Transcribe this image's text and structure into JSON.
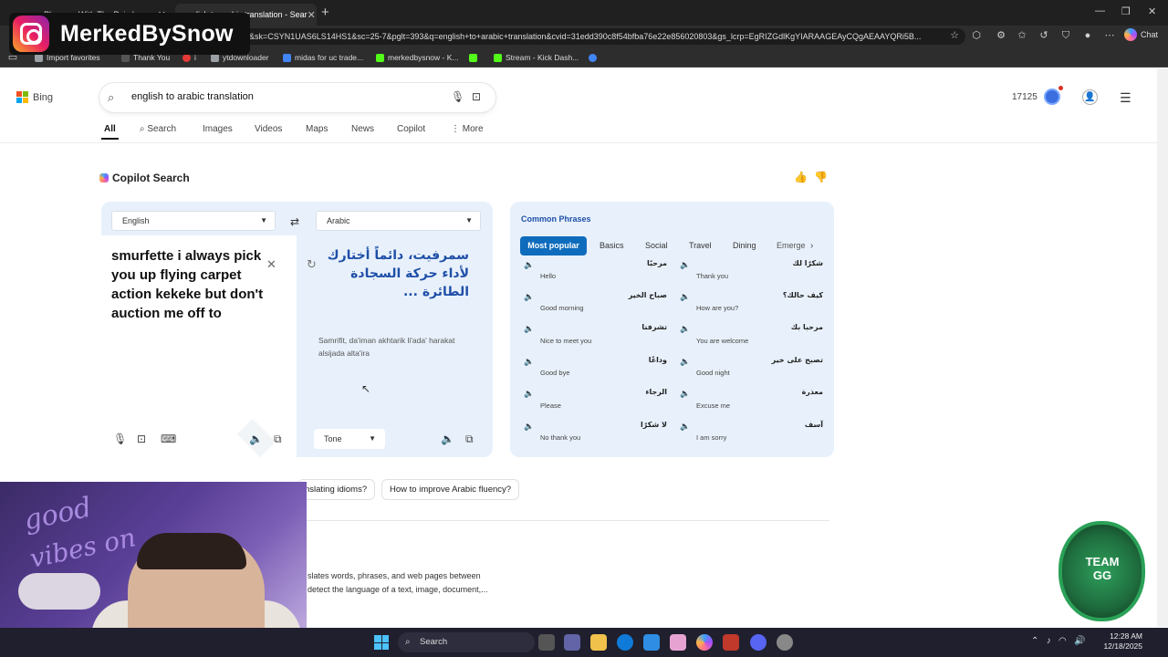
{
  "browser": {
    "tabs": [
      {
        "label": "Pleasure With The Pain by",
        "close": "✕"
      },
      {
        "label": "english to arabic translation - Sear",
        "close": "✕"
      }
    ],
    "new_tab": "+",
    "url": "h&sk=CSYN1UAS6LS14HS1&sc=25-7&pglt=393&q=english+to+arabic+translation&cvid=31edd390c8f54bfba76e22e856020803&gs_lcrp=EgRIZGdlKgYIARAAGEAyCQgAEAAYQRi5B...",
    "chat_label": "Chat",
    "favorites": [
      {
        "label": "Import favorites",
        "color": "#9aa0a6"
      },
      {
        "label": "Thank You",
        "color": "#3a3a3a"
      },
      {
        "label": "i",
        "color": "#e53935"
      },
      {
        "label": "ytdownloader",
        "color": "#9aa0a6"
      },
      {
        "label": "midas for uc trade...",
        "color": "#4285f4"
      },
      {
        "label": "merkedbysnow - K...",
        "color": "#53fc18"
      },
      {
        "label": "",
        "color": "#53fc18"
      },
      {
        "label": "Stream - Kick Dash...",
        "color": "#53fc18"
      },
      {
        "label": "",
        "color": "#4285f4"
      }
    ]
  },
  "overlay": {
    "handle": "MerkedBySnow"
  },
  "bing": {
    "logo": "Bing",
    "query": "english to arabic translation",
    "points": "17125",
    "nav": [
      "All",
      "Search",
      "Images",
      "Videos",
      "Maps",
      "News",
      "Copilot",
      "More"
    ]
  },
  "copilot": {
    "title": "Copilot Search",
    "translator": {
      "source_lang": "English",
      "target_lang": "Arabic",
      "source_text": "smurfette i always pick you up flying carpet action kekeke but don't auction me off to",
      "target_text": "سمرفيت، دائماً أختارك لأداء حركة السجادة الطائرة ...",
      "transliteration": "Samrifit, da'iman akhtarik li'ada' harakat alsijada alta'ira",
      "tone_label": "Tone"
    },
    "phrases": {
      "title": "Common Phrases",
      "tabs": [
        "Most popular",
        "Basics",
        "Social",
        "Travel",
        "Dining",
        "Emerge"
      ],
      "items": [
        {
          "ar": "مرحبًا",
          "en": "Hello"
        },
        {
          "ar": "شكرًا لك",
          "en": "Thank you"
        },
        {
          "ar": "صباح الخير",
          "en": "Good morning"
        },
        {
          "ar": "كيف حالك؟",
          "en": "How are you?"
        },
        {
          "ar": "تشرفنا",
          "en": "Nice to meet you"
        },
        {
          "ar": "مرحبا بك",
          "en": "You are welcome"
        },
        {
          "ar": "وداعًا",
          "en": "Good bye"
        },
        {
          "ar": "تصبح على خير",
          "en": "Good night"
        },
        {
          "ar": "الرجاء",
          "en": "Please"
        },
        {
          "ar": "معذرة",
          "en": "Excuse me"
        },
        {
          "ar": "لا شكرًا",
          "en": "No thank you"
        },
        {
          "ar": "آسف",
          "en": "I am sorry"
        }
      ]
    }
  },
  "suggestions": [
    "nslating idioms?",
    "How to improve Arabic fluency?"
  ],
  "description": {
    "line1": "slates words, phrases, and web pages between",
    "line2": "detect the language of a text, image, document,..."
  },
  "webcam": {
    "neon_line1": "good",
    "neon_line2": "vibes on"
  },
  "badge": {
    "text": "TEAM GG"
  },
  "taskbar": {
    "search_label": "Search",
    "time": "12:28 AM",
    "date": "12/18/2025"
  }
}
